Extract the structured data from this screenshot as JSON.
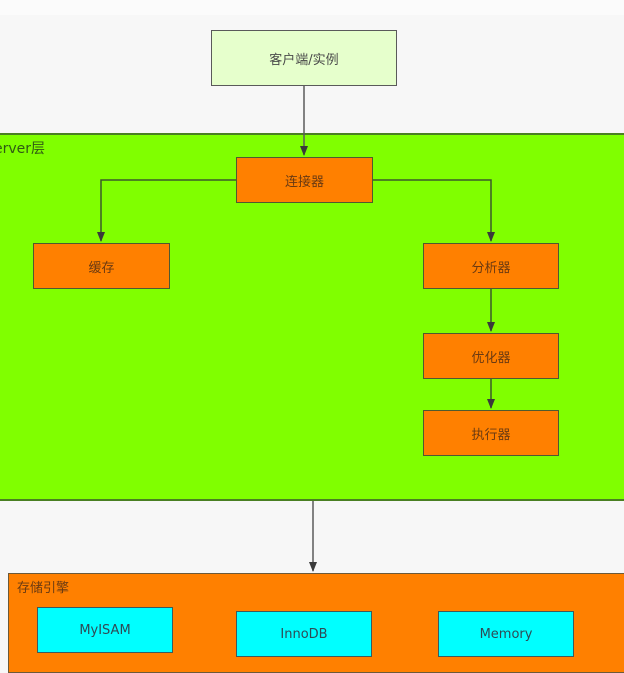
{
  "diagram": {
    "client": {
      "label": "客户端/实例"
    },
    "server_layer": {
      "label": "erver层",
      "nodes": {
        "connector": "连接器",
        "cache": "缓存",
        "analyzer": "分析器",
        "optimizer": "优化器",
        "executor": "执行器"
      }
    },
    "storage_layer": {
      "label": "存储引擎",
      "engines": [
        "MyISAM",
        "InnoDB",
        "Memory"
      ]
    },
    "edges": [
      {
        "from": "client",
        "to": "connector"
      },
      {
        "from": "connector",
        "to": "cache"
      },
      {
        "from": "connector",
        "to": "analyzer"
      },
      {
        "from": "analyzer",
        "to": "optimizer"
      },
      {
        "from": "optimizer",
        "to": "executor"
      },
      {
        "from": "server_layer",
        "to": "storage_layer"
      }
    ],
    "colors": {
      "client_fill": "#e6ffcc",
      "server_fill": "#80ff00",
      "node_fill": "#ff8000",
      "engine_fill": "#00ffff"
    }
  }
}
